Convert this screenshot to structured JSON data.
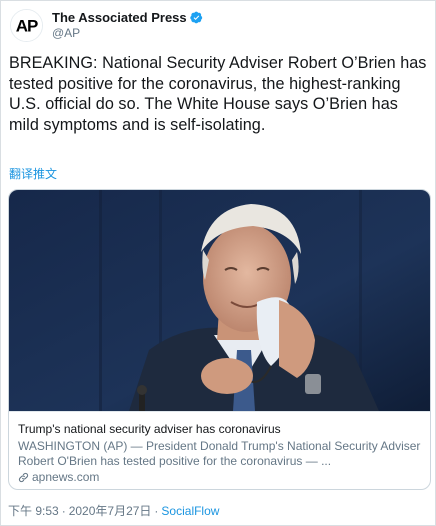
{
  "author": {
    "display_name": "The Associated Press",
    "handle": "@AP",
    "logo_text": "AP"
  },
  "tweet": {
    "text": "BREAKING: National Security Adviser Robert O’Brien has tested positive for the coronavirus, the highest-ranking U.S. official do so. The White House says O’Brien has mild symptoms and is self-isolating.",
    "translate_label": "翻译推文"
  },
  "card": {
    "title": "Trump's national security adviser has coronavirus",
    "description": "WASHINGTON (AP) — President Donald Trump's National Security Adviser Robert O'Brien has tested positive for the coronavirus — ...",
    "domain": "apnews.com"
  },
  "meta": {
    "time": "下午 9:53",
    "date": "2020年7月27日",
    "separator": "·",
    "source": "SocialFlow"
  },
  "colors": {
    "link": "#1b95e0",
    "verified": "#1da1f2",
    "muted": "#657786"
  },
  "icons": [
    "ap-logo-icon",
    "verified-badge-icon",
    "link-icon"
  ]
}
